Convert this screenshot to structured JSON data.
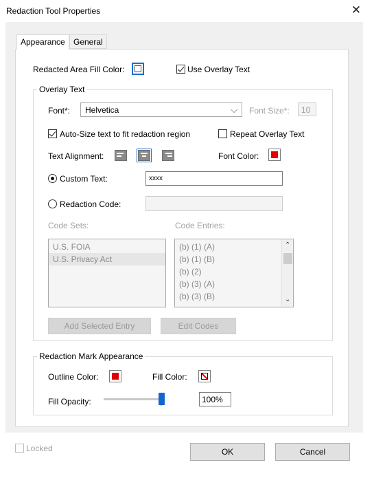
{
  "window": {
    "title": "Redaction Tool Properties",
    "close_glyph": "✕"
  },
  "tabs": [
    {
      "label": "Appearance"
    },
    {
      "label": "General"
    }
  ],
  "appearance": {
    "fill_color_label": "Redacted Area Fill Color:",
    "use_overlay_label": "Use Overlay Text",
    "use_overlay_checked": true
  },
  "overlay": {
    "legend": "Overlay Text",
    "font_label": "Font*:",
    "font_value": "Helvetica",
    "font_size_label": "Font Size*:",
    "font_size_value": "10",
    "autosize_label": "Auto-Size text to fit redaction region",
    "autosize_checked": true,
    "repeat_label": "Repeat Overlay Text",
    "repeat_checked": false,
    "alignment_label": "Text Alignment:",
    "alignment_selected": "center",
    "font_color_label": "Font Color:",
    "font_color": "#e00000",
    "custom_text_label": "Custom Text:",
    "custom_text_value": "xxxx",
    "redaction_code_label": "Redaction Code:",
    "code_sets_label": "Code Sets:",
    "code_entries_label": "Code Entries:",
    "code_sets": [
      "U.S. FOIA",
      "U.S. Privacy Act"
    ],
    "code_entries": [
      "(b) (1) (A)",
      "(b) (1) (B)",
      "(b) (2)",
      "(b) (3) (A)",
      "(b) (3) (B)"
    ],
    "add_entry_label": "Add Selected Entry",
    "edit_codes_label": "Edit Codes"
  },
  "mark": {
    "legend": "Redaction Mark Appearance",
    "outline_label": "Outline Color:",
    "outline_color": "#e00000",
    "fill_label": "Fill Color:",
    "fill_opacity_label": "Fill Opacity:",
    "opacity_value": "100%",
    "opacity_fraction": 1.0
  },
  "footer": {
    "locked_label": "Locked",
    "ok_label": "OK",
    "cancel_label": "Cancel"
  },
  "colors": {
    "accent": "#1366d0",
    "red": "#e00000"
  }
}
